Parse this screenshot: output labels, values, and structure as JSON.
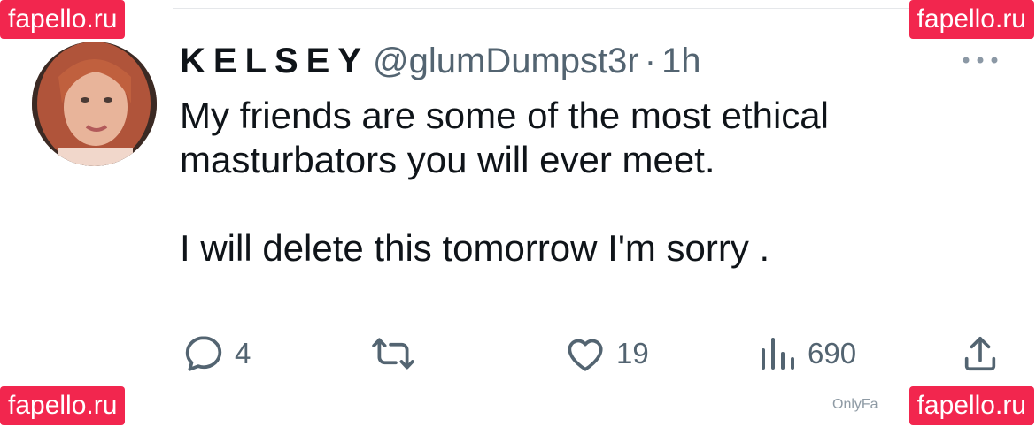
{
  "watermark": {
    "text": "fapello.ru"
  },
  "tweet": {
    "display_name": "KELSEY",
    "handle": "@glumDumpst3r",
    "separator": "·",
    "timestamp": "1h",
    "body_line_1": "My friends are some of the most ethical masturbators you will ever meet.",
    "body_line_2": "I will delete this tomorrow I'm sorry ."
  },
  "actions": {
    "replies": "4",
    "retweets": "",
    "likes": "19",
    "views": "690"
  },
  "footer": {
    "text": "OnlyFa"
  },
  "colors": {
    "accent": "#f2264e",
    "muted": "#536471",
    "text": "#0f1419"
  }
}
